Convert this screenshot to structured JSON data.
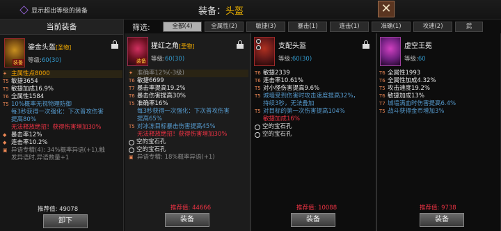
{
  "topbar": {
    "show_over_label": "显示超出等级的装备",
    "title_prefix": "装备：",
    "title_slot": "头盔"
  },
  "current": {
    "header": "当前装备",
    "icon_tag": "装备",
    "name": "鎏金头盔",
    "grade": "[圣物]",
    "level_label": "等级:",
    "level": "60(30)",
    "stats": [
      {
        "tier": "✦",
        "text": "主属性点8000",
        "color": "c-orange"
      },
      {
        "tier": "T5",
        "text": "敏捷3654",
        "color": "c-white"
      },
      {
        "tier": "T5",
        "text": "敏捷加成16.9%",
        "color": "c-white"
      },
      {
        "tier": "T6",
        "text": "全属性1584",
        "color": "c-white"
      },
      {
        "tier": "T5",
        "text": "10%概率无视物理防御",
        "color": "c-blue"
      },
      {
        "tier": "",
        "text": "每3秒获得一次强化：下次普攻伤害提高80%",
        "color": "c-blue",
        "wrap": true
      },
      {
        "tier": "",
        "text": "无法释放绝招！获得伤害增加30%",
        "color": "c-red"
      },
      {
        "tier": "◆",
        "text": "暴击率12%",
        "color": "c-white"
      },
      {
        "tier": "◆",
        "text": "连击率10.2%",
        "color": "c-white"
      },
      {
        "tier": "▣",
        "text": "异语专精(4): 34%概率异语(+1),触发异语时,异语数量+1",
        "color": "c-gray",
        "wrap": true
      }
    ],
    "score_label": "推荐值: ",
    "score": "49078",
    "button": "卸下"
  },
  "filter": {
    "label": "筛选:",
    "tabs": [
      "全部(4)",
      "全属性(2)",
      "敏捷(3)",
      "暴击(1)",
      "连击(1)",
      "准确(1)",
      "攻速(2)",
      "武"
    ]
  },
  "candidates": [
    {
      "icon_tag": "装备",
      "name": "猩红之角",
      "grade": "[圣物]",
      "level_label": "等级:",
      "level": "60(30)",
      "stats": [
        {
          "tier": "✦",
          "text": "准确率12%(-3级)",
          "color": "c-gray"
        },
        {
          "tier": "T6",
          "text": "敏捷6699",
          "color": "c-white"
        },
        {
          "tier": "T7",
          "text": "暴击率提高19.2%",
          "color": "c-white"
        },
        {
          "tier": "T6",
          "text": "暴击伤害提高30%",
          "color": "c-white"
        },
        {
          "tier": "T5",
          "text": "准确率16%",
          "color": "c-white"
        },
        {
          "tier": "",
          "text": "每3秒获得一次强化：下次普攻伤害提高65%",
          "color": "c-blue",
          "wrap": true
        },
        {
          "tier": "T5",
          "text": "对冰冻目标暴击伤害提高45%",
          "color": "c-blue"
        },
        {
          "tier": "",
          "text": "无法释放绝招！获得伤害增加30%",
          "color": "c-red"
        }
      ],
      "gems": [
        "空的宝石孔",
        "空的宝石孔"
      ],
      "note": "异语专精: 18%概率异语(+1)",
      "score_label": "推荐值: ",
      "score": "44666",
      "button": "装备"
    },
    {
      "icon_tag": "",
      "name": "支配头盔",
      "grade": "",
      "level_label": "等级:",
      "level": "60(30)",
      "stats": [
        {
          "tier": "T6",
          "text": "敏捷2339",
          "color": "c-white"
        },
        {
          "tier": "T6",
          "text": "连击率10.61%",
          "color": "c-white"
        },
        {
          "tier": "T5",
          "text": "对小怪伤害提高9.6%",
          "color": "c-white"
        },
        {
          "tier": "T5",
          "text": "城墙受到伤害时攻击速度提高32%，持续3秒，无法叠加",
          "color": "c-blue",
          "wrap": true
        },
        {
          "tier": "T5",
          "text": "对目标的第一次伤害提高104%",
          "color": "c-blue"
        },
        {
          "tier": "",
          "text": "敏捷加成16%",
          "color": "c-red"
        }
      ],
      "gems": [
        "空的宝石孔",
        "空的宝石孔"
      ],
      "note": "",
      "score_label": "推荐值: ",
      "score": "10088",
      "button": "装备"
    },
    {
      "icon_tag": "",
      "name": "虚空王冕",
      "grade": "",
      "level_label": "等级:",
      "level": "60",
      "stats": [
        {
          "tier": "T6",
          "text": "全属性1993",
          "color": "c-white"
        },
        {
          "tier": "T6",
          "text": "全属性加成4.32%",
          "color": "c-white"
        },
        {
          "tier": "T5",
          "text": "攻击速度19.2%",
          "color": "c-white"
        },
        {
          "tier": "T6",
          "text": "敏捷加成13%",
          "color": "c-white"
        },
        {
          "tier": "T7",
          "text": "城墙满血时伤害提高6.4%",
          "color": "c-blue"
        },
        {
          "tier": "T5",
          "text": "战斗获得金币增加3%",
          "color": "c-blue"
        }
      ],
      "gems": [],
      "note": "",
      "score_label": "推荐值: ",
      "score": "9738",
      "button": "装备"
    }
  ]
}
